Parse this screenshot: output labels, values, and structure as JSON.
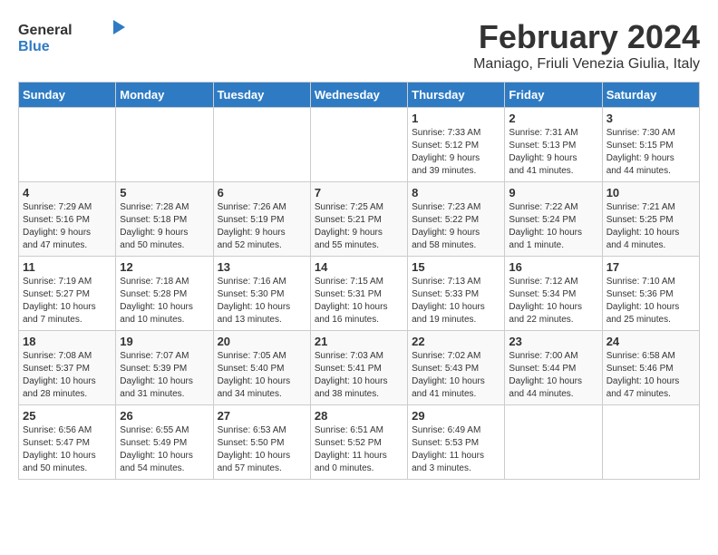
{
  "header": {
    "logo_general": "General",
    "logo_blue": "Blue",
    "title": "February 2024",
    "subtitle": "Maniago, Friuli Venezia Giulia, Italy"
  },
  "columns": [
    "Sunday",
    "Monday",
    "Tuesday",
    "Wednesday",
    "Thursday",
    "Friday",
    "Saturday"
  ],
  "weeks": [
    [
      {
        "day": "",
        "info": ""
      },
      {
        "day": "",
        "info": ""
      },
      {
        "day": "",
        "info": ""
      },
      {
        "day": "",
        "info": ""
      },
      {
        "day": "1",
        "info": "Sunrise: 7:33 AM\nSunset: 5:12 PM\nDaylight: 9 hours\nand 39 minutes."
      },
      {
        "day": "2",
        "info": "Sunrise: 7:31 AM\nSunset: 5:13 PM\nDaylight: 9 hours\nand 41 minutes."
      },
      {
        "day": "3",
        "info": "Sunrise: 7:30 AM\nSunset: 5:15 PM\nDaylight: 9 hours\nand 44 minutes."
      }
    ],
    [
      {
        "day": "4",
        "info": "Sunrise: 7:29 AM\nSunset: 5:16 PM\nDaylight: 9 hours\nand 47 minutes."
      },
      {
        "day": "5",
        "info": "Sunrise: 7:28 AM\nSunset: 5:18 PM\nDaylight: 9 hours\nand 50 minutes."
      },
      {
        "day": "6",
        "info": "Sunrise: 7:26 AM\nSunset: 5:19 PM\nDaylight: 9 hours\nand 52 minutes."
      },
      {
        "day": "7",
        "info": "Sunrise: 7:25 AM\nSunset: 5:21 PM\nDaylight: 9 hours\nand 55 minutes."
      },
      {
        "day": "8",
        "info": "Sunrise: 7:23 AM\nSunset: 5:22 PM\nDaylight: 9 hours\nand 58 minutes."
      },
      {
        "day": "9",
        "info": "Sunrise: 7:22 AM\nSunset: 5:24 PM\nDaylight: 10 hours\nand 1 minute."
      },
      {
        "day": "10",
        "info": "Sunrise: 7:21 AM\nSunset: 5:25 PM\nDaylight: 10 hours\nand 4 minutes."
      }
    ],
    [
      {
        "day": "11",
        "info": "Sunrise: 7:19 AM\nSunset: 5:27 PM\nDaylight: 10 hours\nand 7 minutes."
      },
      {
        "day": "12",
        "info": "Sunrise: 7:18 AM\nSunset: 5:28 PM\nDaylight: 10 hours\nand 10 minutes."
      },
      {
        "day": "13",
        "info": "Sunrise: 7:16 AM\nSunset: 5:30 PM\nDaylight: 10 hours\nand 13 minutes."
      },
      {
        "day": "14",
        "info": "Sunrise: 7:15 AM\nSunset: 5:31 PM\nDaylight: 10 hours\nand 16 minutes."
      },
      {
        "day": "15",
        "info": "Sunrise: 7:13 AM\nSunset: 5:33 PM\nDaylight: 10 hours\nand 19 minutes."
      },
      {
        "day": "16",
        "info": "Sunrise: 7:12 AM\nSunset: 5:34 PM\nDaylight: 10 hours\nand 22 minutes."
      },
      {
        "day": "17",
        "info": "Sunrise: 7:10 AM\nSunset: 5:36 PM\nDaylight: 10 hours\nand 25 minutes."
      }
    ],
    [
      {
        "day": "18",
        "info": "Sunrise: 7:08 AM\nSunset: 5:37 PM\nDaylight: 10 hours\nand 28 minutes."
      },
      {
        "day": "19",
        "info": "Sunrise: 7:07 AM\nSunset: 5:39 PM\nDaylight: 10 hours\nand 31 minutes."
      },
      {
        "day": "20",
        "info": "Sunrise: 7:05 AM\nSunset: 5:40 PM\nDaylight: 10 hours\nand 34 minutes."
      },
      {
        "day": "21",
        "info": "Sunrise: 7:03 AM\nSunset: 5:41 PM\nDaylight: 10 hours\nand 38 minutes."
      },
      {
        "day": "22",
        "info": "Sunrise: 7:02 AM\nSunset: 5:43 PM\nDaylight: 10 hours\nand 41 minutes."
      },
      {
        "day": "23",
        "info": "Sunrise: 7:00 AM\nSunset: 5:44 PM\nDaylight: 10 hours\nand 44 minutes."
      },
      {
        "day": "24",
        "info": "Sunrise: 6:58 AM\nSunset: 5:46 PM\nDaylight: 10 hours\nand 47 minutes."
      }
    ],
    [
      {
        "day": "25",
        "info": "Sunrise: 6:56 AM\nSunset: 5:47 PM\nDaylight: 10 hours\nand 50 minutes."
      },
      {
        "day": "26",
        "info": "Sunrise: 6:55 AM\nSunset: 5:49 PM\nDaylight: 10 hours\nand 54 minutes."
      },
      {
        "day": "27",
        "info": "Sunrise: 6:53 AM\nSunset: 5:50 PM\nDaylight: 10 hours\nand 57 minutes."
      },
      {
        "day": "28",
        "info": "Sunrise: 6:51 AM\nSunset: 5:52 PM\nDaylight: 11 hours\nand 0 minutes."
      },
      {
        "day": "29",
        "info": "Sunrise: 6:49 AM\nSunset: 5:53 PM\nDaylight: 11 hours\nand 3 minutes."
      },
      {
        "day": "",
        "info": ""
      },
      {
        "day": "",
        "info": ""
      }
    ]
  ]
}
